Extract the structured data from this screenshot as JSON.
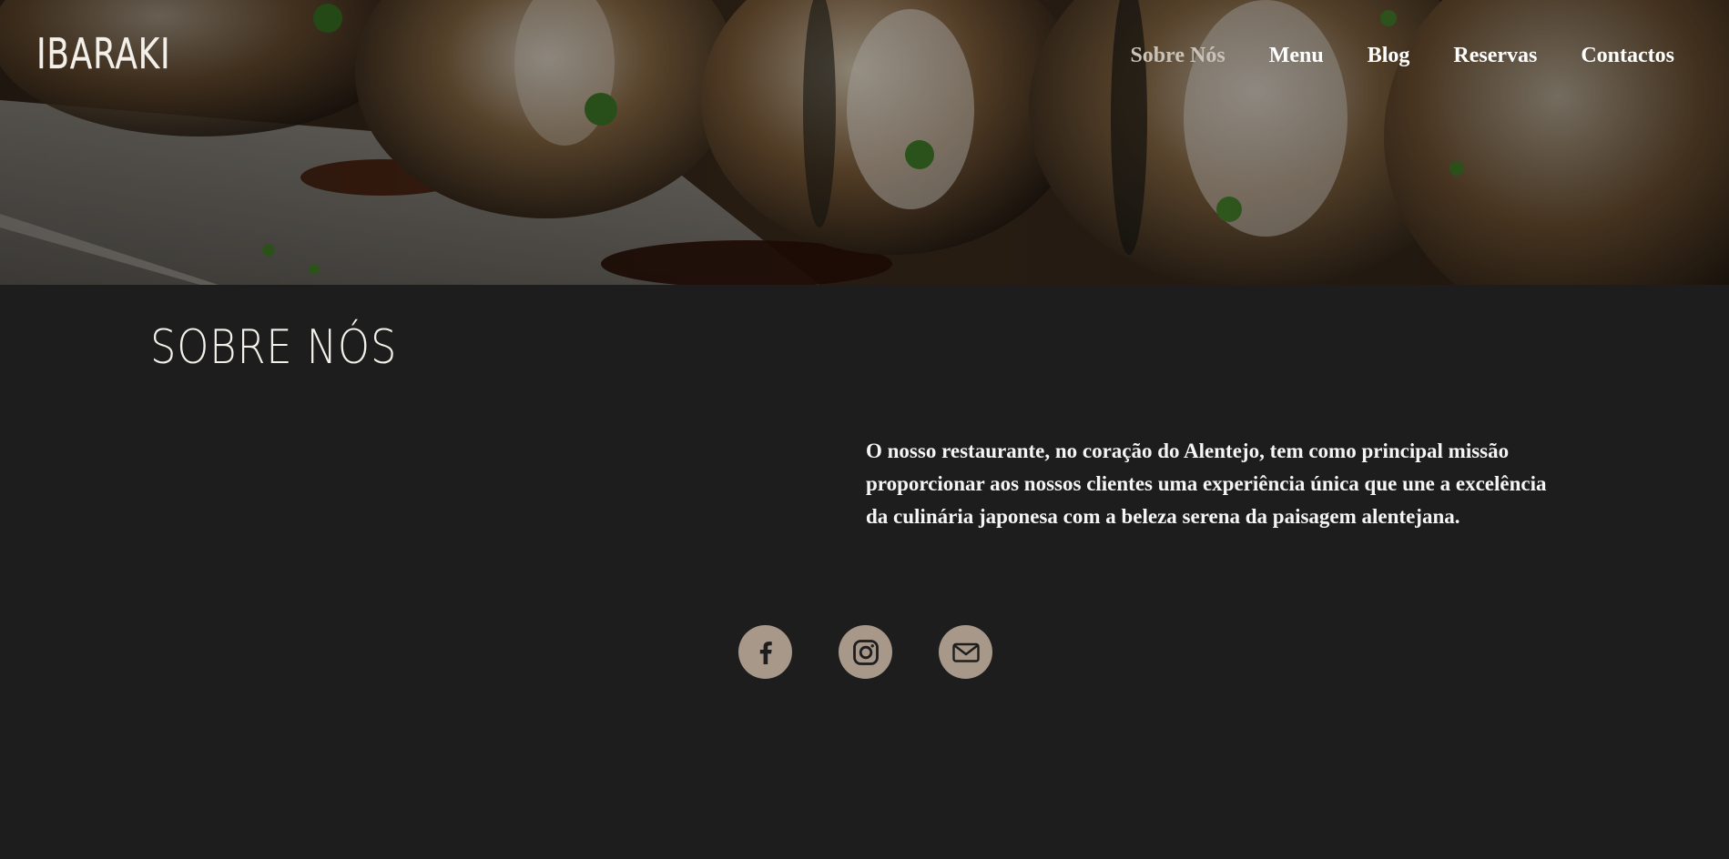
{
  "brand": {
    "logo_text": "IBARAKI"
  },
  "nav": {
    "items": [
      {
        "label": "Sobre Nós",
        "active": true
      },
      {
        "label": "Menu",
        "active": false
      },
      {
        "label": "Blog",
        "active": false
      },
      {
        "label": "Reservas",
        "active": false
      },
      {
        "label": "Contactos",
        "active": false
      }
    ]
  },
  "hero": {
    "image_subject": "tempura sushi rolls"
  },
  "about": {
    "title": "SOBRE NÓS",
    "body": "O nosso restaurante, no coração do Alentejo, tem como principal missão proporcionar aos nossos clientes uma experiência única que une a excelência da culinária japonesa com a beleza serena da paisagem alentejana."
  },
  "socials": [
    {
      "icon": "facebook-icon"
    },
    {
      "icon": "instagram-icon"
    },
    {
      "icon": "email-icon"
    }
  ],
  "colors": {
    "background": "#1d1d1d",
    "accent": "#a8988a",
    "nav_active": "#c9c2b8"
  }
}
